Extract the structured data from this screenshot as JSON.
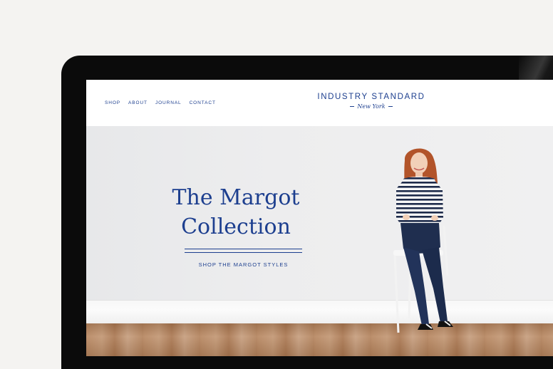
{
  "nav": {
    "items": [
      "SHOP",
      "ABOUT",
      "JOURNAL",
      "CONTACT"
    ]
  },
  "logo": {
    "title": "INDUSTRY STANDARD",
    "subtitle": "New York"
  },
  "hero": {
    "title_line1": "The Margot",
    "title_line2": "Collection",
    "cta": "SHOP THE MARGOT STYLES"
  },
  "colors": {
    "brand_blue": "#1d3f8f",
    "page_bg": "#f4f3f1",
    "device_frame": "#0b0b0b"
  }
}
